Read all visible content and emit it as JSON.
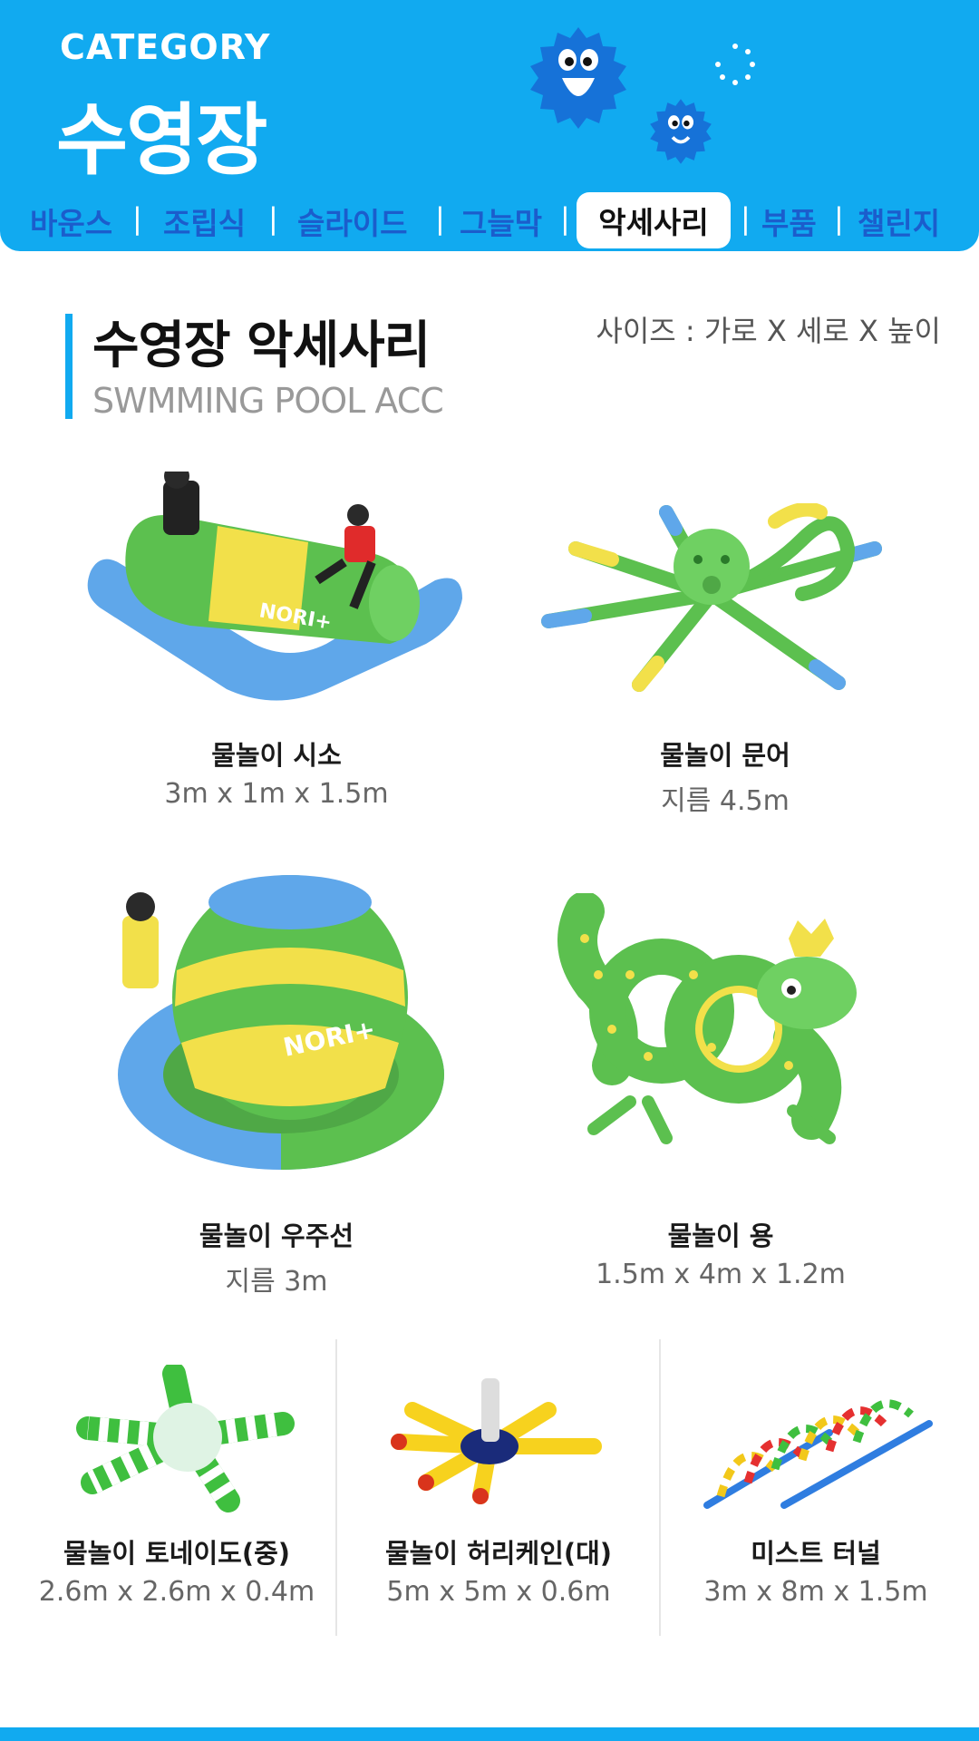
{
  "header": {
    "category_label": "CATEGORY",
    "category_title": "수영장",
    "tabs": [
      {
        "label": "바운스"
      },
      {
        "label": "조립식"
      },
      {
        "label": "슬라이드"
      },
      {
        "label": "그늘막"
      },
      {
        "label": "악세사리"
      },
      {
        "label": "부품"
      },
      {
        "label": "챌린지"
      }
    ],
    "active_tab": "악세사리"
  },
  "section": {
    "title": "수영장 악세사리",
    "subtitle": "SWMMING POOL ACC",
    "size_note": "사이즈 : 가로 X 세로 X 높이"
  },
  "products": [
    {
      "name": "물놀이 시소",
      "dim": "3m x 1m x 1.5m",
      "icon": "seesaw-image"
    },
    {
      "name": "물놀이 문어",
      "dim": "지름 4.5m",
      "icon": "octopus-image"
    },
    {
      "name": "물놀이 우주선",
      "dim": "지름 3m",
      "icon": "spaceship-image"
    },
    {
      "name": "물놀이 용",
      "dim": "1.5m x 4m x 1.2m",
      "icon": "dragon-image"
    },
    {
      "name": "물놀이 토네이도(중)",
      "dim": "2.6m x 2.6m x 0.4m",
      "icon": "tornado-image"
    },
    {
      "name": "물놀이 허리케인(대)",
      "dim": "5m x 5m x 0.6m",
      "icon": "hurricane-image"
    },
    {
      "name": "미스트 터널",
      "dim": "3m x 8m x 1.5m",
      "icon": "mist-tunnel-image"
    }
  ],
  "colors": {
    "brand_blue": "#11aaf0",
    "tab_text": "#1b5dcc",
    "green": "#5cc04f",
    "yellow": "#f2e04a",
    "light_blue": "#5fa7ea"
  }
}
